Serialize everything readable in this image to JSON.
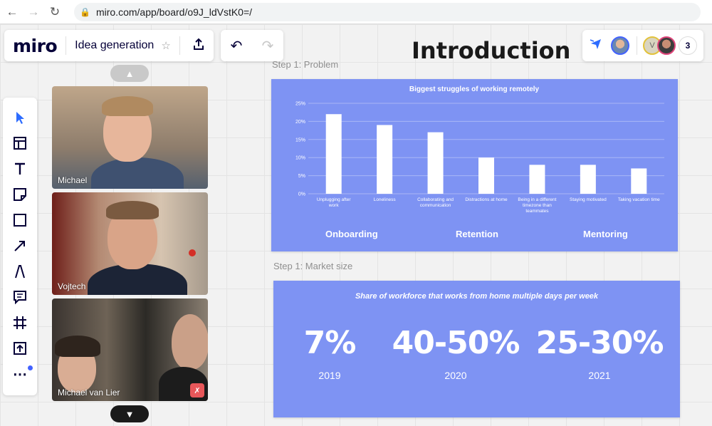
{
  "browser": {
    "url": "miro.com/app/board/o9J_ldVstK0=/"
  },
  "header": {
    "logo": "miro",
    "board_name": "Idea generation",
    "collaborator_count": "3",
    "avatar_initial": "V"
  },
  "colors": {
    "frame_bg": "#7e93f3",
    "accent": "#4262ff"
  },
  "videos": [
    {
      "name": "Michael"
    },
    {
      "name": "Vojtech"
    },
    {
      "name": "Michael van Lier"
    }
  ],
  "canvas": {
    "title": "Introduction",
    "frame1_label": "Step 1: Problem",
    "frame2_label": "Step 1: Market size",
    "frame1_footers": [
      "Onboarding",
      "Retention",
      "Mentoring"
    ]
  },
  "chart_data": {
    "type": "bar",
    "title": "Biggest struggles of working remotely",
    "categories": [
      [
        "Unplugging after",
        "work"
      ],
      [
        "Loneliness"
      ],
      [
        "Collaborating and",
        "communication"
      ],
      [
        "Distractions at home"
      ],
      [
        "Being in a different",
        "timezone than",
        "teammates"
      ],
      [
        "Staying motivated"
      ],
      [
        "Taking vacation time"
      ]
    ],
    "values": [
      22,
      19,
      17,
      10,
      8,
      8,
      7
    ],
    "yticks": [
      "0%",
      "5%",
      "10%",
      "15%",
      "20%",
      "25%"
    ],
    "ylim": [
      0,
      25
    ],
    "grid": true,
    "bar_color": "#ffffff"
  },
  "market": {
    "title": "Share of workforce that works from home multiple days per week",
    "stats": [
      {
        "value": "7%",
        "year": "2019"
      },
      {
        "value": "40-50%",
        "year": "2020"
      },
      {
        "value": "25-30%",
        "year": "2021"
      }
    ]
  }
}
